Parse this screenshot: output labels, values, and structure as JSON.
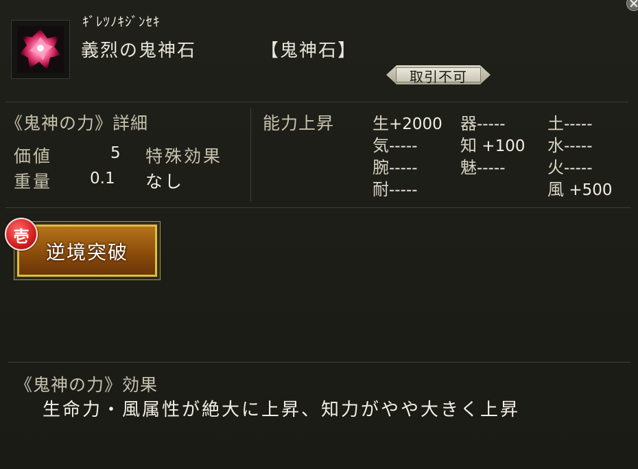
{
  "item": {
    "furigana": "ｷﾞﾚﾂﾉｷｼﾞﾝｾｷ",
    "name": "義烈の鬼神石",
    "category": "【鬼神石】",
    "trade_status": "取引不可",
    "icon": "pink-crystal-gem-icon"
  },
  "details": {
    "title": "《鬼神の力》詳細",
    "value_label": "価値",
    "value": "5",
    "weight_label": "重量",
    "weight": "0.1",
    "special_label": "特殊効果",
    "special_value": "なし"
  },
  "ability": {
    "title": "能力上昇",
    "stats": [
      {
        "key": "生",
        "value": "+2000"
      },
      {
        "key": "器",
        "value": "-----"
      },
      {
        "key": "土",
        "value": "-----"
      },
      {
        "key": "気",
        "value": "-----"
      },
      {
        "key": "知",
        "value": " +100"
      },
      {
        "key": "水",
        "value": "-----"
      },
      {
        "key": "腕",
        "value": "-----"
      },
      {
        "key": "魅",
        "value": "-----"
      },
      {
        "key": "火",
        "value": "-----"
      },
      {
        "key": "耐",
        "value": "-----"
      },
      {
        "key": "風",
        "value": " +500"
      }
    ]
  },
  "skill": {
    "rank": "壱",
    "label": "逆境突破"
  },
  "effect": {
    "title": "《鬼神の力》効果",
    "text": "生命力・風属性が絶大に上昇、知力がやや大きく上昇"
  },
  "colors": {
    "background": "#1c1c17",
    "label": "#c6c2ad",
    "text": "#f0ede4",
    "button_gold": "#e2be3c",
    "button_brown": "#8c4d0c",
    "badge_red": "#d11f1f"
  }
}
